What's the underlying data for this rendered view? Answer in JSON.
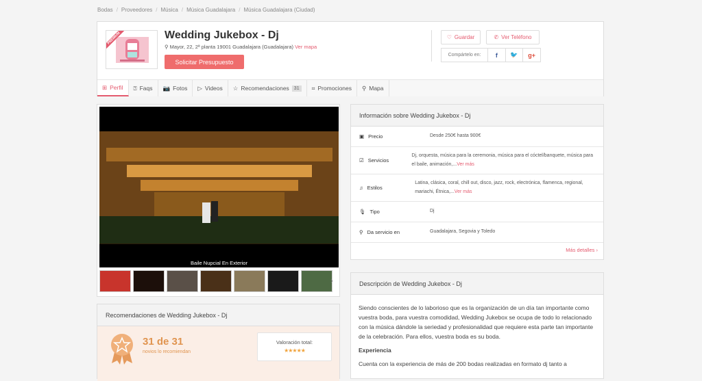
{
  "breadcrumb": [
    "Bodas",
    "Proveedores",
    "Música",
    "Música Guadalajara",
    "Música Guadalajara (Ciudad)"
  ],
  "vendor": {
    "badge": "PREMIUM",
    "name": "Wedding Jukebox - Dj",
    "address": "Mayor, 22, 2ª planta 19001 Guadalajara (Guadalajara)",
    "map_link": "Ver mapa",
    "request_button": "Solicitar Presupuesto",
    "save_button": "Guardar",
    "phone_button": "Ver Teléfono",
    "share_label": "Compártelo en:"
  },
  "tabs": [
    {
      "label": "Perfil",
      "icon": "grid-icon"
    },
    {
      "label": "Faqs",
      "icon": "question-icon"
    },
    {
      "label": "Fotos",
      "icon": "camera-icon"
    },
    {
      "label": "Videos",
      "icon": "play-icon"
    },
    {
      "label": "Recomendaciones",
      "icon": "star-icon",
      "count": "31"
    },
    {
      "label": "Promociones",
      "icon": "tag-icon"
    },
    {
      "label": "Mapa",
      "icon": "pin-icon"
    }
  ],
  "gallery": {
    "caption": "Baile Nupcial En Exterior"
  },
  "info": {
    "title": "Información sobre Wedding Jukebox - Dj",
    "rows": [
      {
        "label": "Precio",
        "value": "Desde 250€ hasta 900€",
        "icon": "money-icon"
      },
      {
        "label": "Servicios",
        "value": "Dj, orquesta, música para la ceremonia, música para el cóctel/banquete, música para el baile, animación,...",
        "more": "Ver más",
        "icon": "check-icon"
      },
      {
        "label": "Estilos",
        "value": "Latina, clásica, coral, chill out, disco, jazz, rock, electrónica, flamenca, regional, mariachi, Étnica,...",
        "more": "Ver más",
        "icon": "music-icon"
      },
      {
        "label": "Tipo",
        "value": "Dj",
        "icon": "mic-icon"
      },
      {
        "label": "Da servicio en",
        "value": "Guadalajara, Segovia y Toledo",
        "icon": "pin-icon"
      }
    ],
    "more_details": "Más detalles"
  },
  "description": {
    "title": "Descripción de Wedding Jukebox - Dj",
    "paragraph": "Siendo conscientes de lo laborioso que es la organización de un día tan importante como vuestra boda, para vuestra comodidad, Wedding Jukebox se ocupa de todo lo relacionado con la música dándole la seriedad y profesionalidad que requiere esta parte tan importante de la celebración. Para ellos, vuestra boda es su boda.",
    "subheading": "Experiencia",
    "paragraph2": "Cuenta con la experiencia de más de 200 bodas realizadas en formato dj tanto a"
  },
  "recommendations": {
    "title": "Recomendaciones de Wedding Jukebox - Dj",
    "score": "31 de 31",
    "subtitle": "novios lo recomiendan",
    "rating_label": "Valoración total:",
    "stars": "★★★★★"
  }
}
